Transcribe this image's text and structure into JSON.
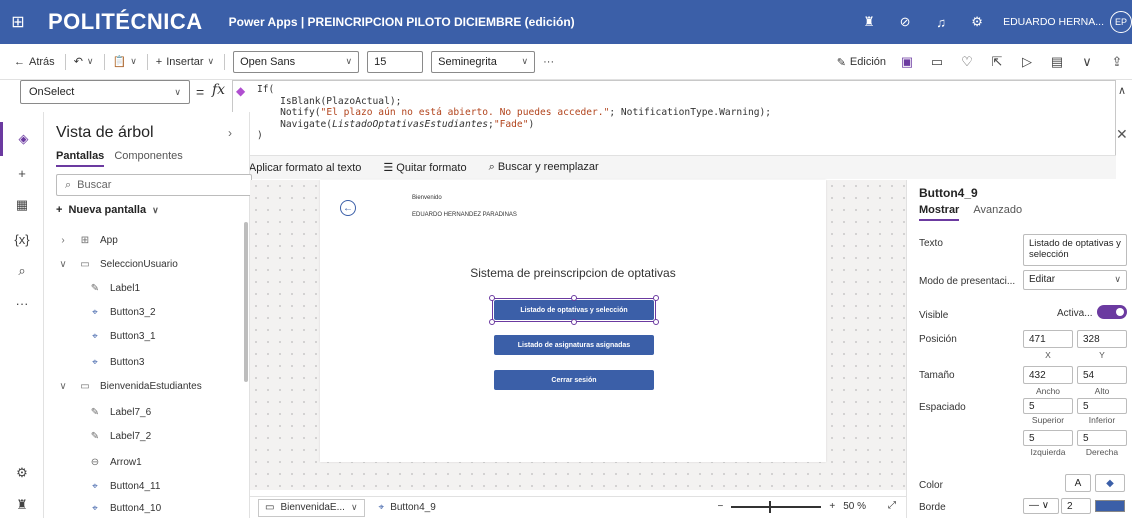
{
  "topbar": {
    "brand": "POLITÉCNICA",
    "app_title": "Power Apps | PREINCRIPCION PILOTO DICIEMBRE (edición)",
    "user_name": "EDUARDO HERNA...",
    "avatar_initials": "EP"
  },
  "commandbar": {
    "back_label": "Atrás",
    "insert_label": "Insertar",
    "font_family": "Open Sans",
    "font_size": "15",
    "font_weight": "Seminegrita",
    "more": "···",
    "edit_label": "Edición"
  },
  "formula": {
    "property": "OnSelect",
    "equals": "=",
    "fx": "fx",
    "line1": "If(",
    "line2": "    IsBlank(PlazoActual);",
    "line3_a": "    Notify(",
    "line3_str": "\"El plazo aún no está abierto. No puedes acceder.\"",
    "line3_b": "; NotificationType.Warning);",
    "line4_a": "    Navigate(",
    "line4_it": "ListadoOptativasEstudiantes",
    "line4_b": ";",
    "line4_str": "\"Fade\"",
    "line4_c": ")",
    "line5": ")",
    "tool_format": "Aplicar formato al texto",
    "tool_remove": "Quitar formato",
    "tool_find": "Buscar y reemplazar"
  },
  "tree": {
    "title": "Vista de árbol",
    "tab_screens": "Pantallas",
    "tab_components": "Componentes",
    "search_placeholder": "Buscar",
    "new_screen": "Nueva pantalla",
    "items": [
      {
        "label": "App"
      },
      {
        "label": "SeleccionUsuario"
      },
      {
        "label": "Label1"
      },
      {
        "label": "Button3_2"
      },
      {
        "label": "Button3_1"
      },
      {
        "label": "Button3"
      },
      {
        "label": "BienvenidaEstudiantes"
      },
      {
        "label": "Label7_6"
      },
      {
        "label": "Label7_2"
      },
      {
        "label": "Arrow1"
      },
      {
        "label": "Button4_11"
      },
      {
        "label": "Button4_10"
      }
    ]
  },
  "canvas": {
    "welcome": "Bienvenido",
    "username": "EDUARDO HERNANDEZ PARADINAS",
    "title": "Sistema de preinscripcion de optativas",
    "btn1": "Listado de optativas y selección",
    "btn2": "Listado de asignaturas asignadas",
    "btn3": "Cerrar sesión"
  },
  "bottom": {
    "screen_crumb": "BienvenidaE...",
    "control_crumb": "Button4_9",
    "zoom_minus": "−",
    "zoom_plus": "+",
    "zoom": "50 %"
  },
  "props": {
    "title": "Button4_9",
    "tab_show": "Mostrar",
    "tab_advanced": "Avanzado",
    "text_label": "Texto",
    "text_value": "Listado de optativas y selección",
    "mode_label": "Modo de presentaci...",
    "mode_value": "Editar",
    "visible_label": "Visible",
    "visible_value": "Activa...",
    "position_label": "Posición",
    "pos_x": "471",
    "pos_y": "328",
    "cap_x": "X",
    "cap_y": "Y",
    "size_label": "Tamaño",
    "width": "432",
    "height": "54",
    "cap_w": "Ancho",
    "cap_h": "Alto",
    "spacing_label": "Espaciado",
    "pad_top": "5",
    "pad_bottom": "5",
    "pad_left": "5",
    "pad_right": "5",
    "cap_top": "Superior",
    "cap_bottom": "Inferior",
    "cap_left": "Izquierda",
    "cap_right": "Derecha",
    "color_label": "Color",
    "color_letter": "A",
    "border_label": "Borde",
    "border_value": "2"
  },
  "colors": {
    "accent": "#3b5fa8",
    "purple": "#6b3aa0"
  }
}
